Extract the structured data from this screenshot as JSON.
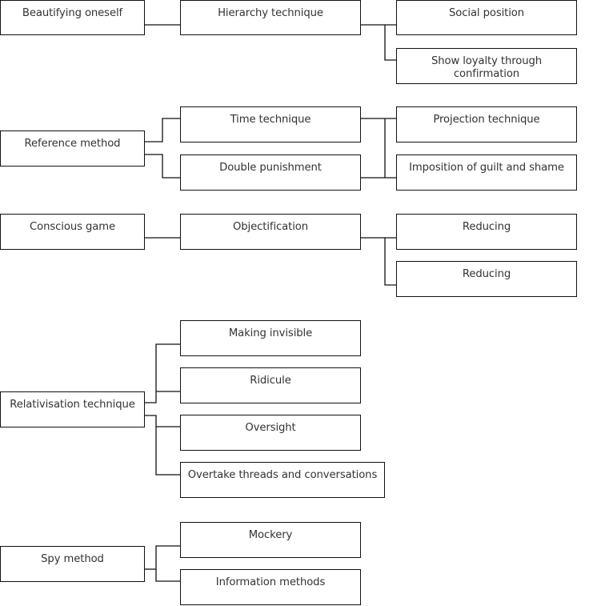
{
  "diagram": {
    "groups": [
      {
        "root": "Beautifying oneself",
        "children": [
          {
            "label": "Hierarchy technique",
            "children": [
              "Social position",
              "Show loyalty through confirmation"
            ]
          }
        ]
      },
      {
        "root": "Reference method",
        "children": [
          {
            "label": "Time technique",
            "children": [
              "Projection technique"
            ]
          },
          {
            "label": "Double punishment",
            "children": [
              "Imposition of guilt and shame"
            ]
          }
        ]
      },
      {
        "root": "Conscious game",
        "children": [
          {
            "label": "Objectification",
            "children": [
              "Reducing",
              "Reducing"
            ]
          }
        ]
      },
      {
        "root": "Relativisation technique",
        "children": [
          {
            "label": "Making invisible"
          },
          {
            "label": "Ridicule"
          },
          {
            "label": "Oversight"
          },
          {
            "label": "Overtake threads and conversations"
          }
        ]
      },
      {
        "root": "Spy method",
        "children": [
          {
            "label": "Mockery"
          },
          {
            "label": "Information methods"
          }
        ]
      }
    ]
  }
}
